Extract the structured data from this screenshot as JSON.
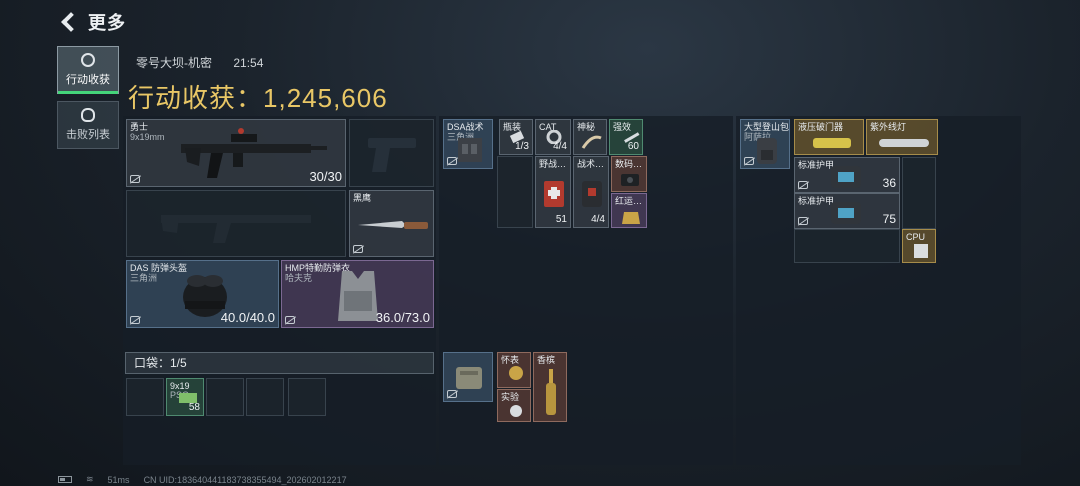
{
  "header": {
    "back_label": "更多"
  },
  "tabs": [
    {
      "label": "行动收获",
      "icon": "target-icon"
    },
    {
      "label": "击败列表",
      "icon": "skull-icon"
    }
  ],
  "raid": {
    "map": "零号大坝-机密",
    "time": "21:54",
    "earn_label": "行动收获：",
    "earn_value": "1,245,606"
  },
  "loadout": {
    "primary": {
      "name": "勇士",
      "ammo_type": "9x19mm",
      "ammo": "30/30"
    },
    "melee": {
      "name": "黑鹰"
    },
    "helmet": {
      "name": "DAS 防弹头盔",
      "origin": "三角洲",
      "durability": "40.0/40.0"
    },
    "armor": {
      "name": "HMP特勤防弹衣",
      "origin": "哈夫克",
      "durability": "36.0/73.0"
    }
  },
  "pocket": {
    "label": "口袋：1/5",
    "item": {
      "name": "9x19",
      "sub": "PSO",
      "qty": "58"
    }
  },
  "chest_rig": {
    "name": "DSA战术",
    "sub": "三角洲",
    "items": [
      {
        "name": "瓶装",
        "qty": "1/3"
      },
      {
        "name": "CAT",
        "qty": "4/4"
      },
      {
        "name": "神秘",
        "qty": ""
      },
      {
        "name": "强效",
        "qty": "60"
      },
      {
        "name": "野战…",
        "qty": "51"
      },
      {
        "name": "战术…",
        "qty": "4/4"
      },
      {
        "name": "数码…",
        "qty": ""
      },
      {
        "name": "红运…",
        "qty": ""
      }
    ]
  },
  "backpack": {
    "name": "大型登山包",
    "sub": "阿萨拉",
    "items": [
      {
        "name": "液压破门器"
      },
      {
        "name": "紫外线灯"
      },
      {
        "name": "标准护甲",
        "qty": "36"
      },
      {
        "name": "标准护甲",
        "qty": "75"
      },
      {
        "name": "CPU"
      }
    ]
  },
  "case": {
    "items": [
      {
        "name": "怀表"
      },
      {
        "name": "香槟"
      },
      {
        "name": "实验"
      }
    ]
  },
  "footer": {
    "ping": "51ms",
    "uid": "CN UID:18364044118373835549​4_202602012217"
  }
}
